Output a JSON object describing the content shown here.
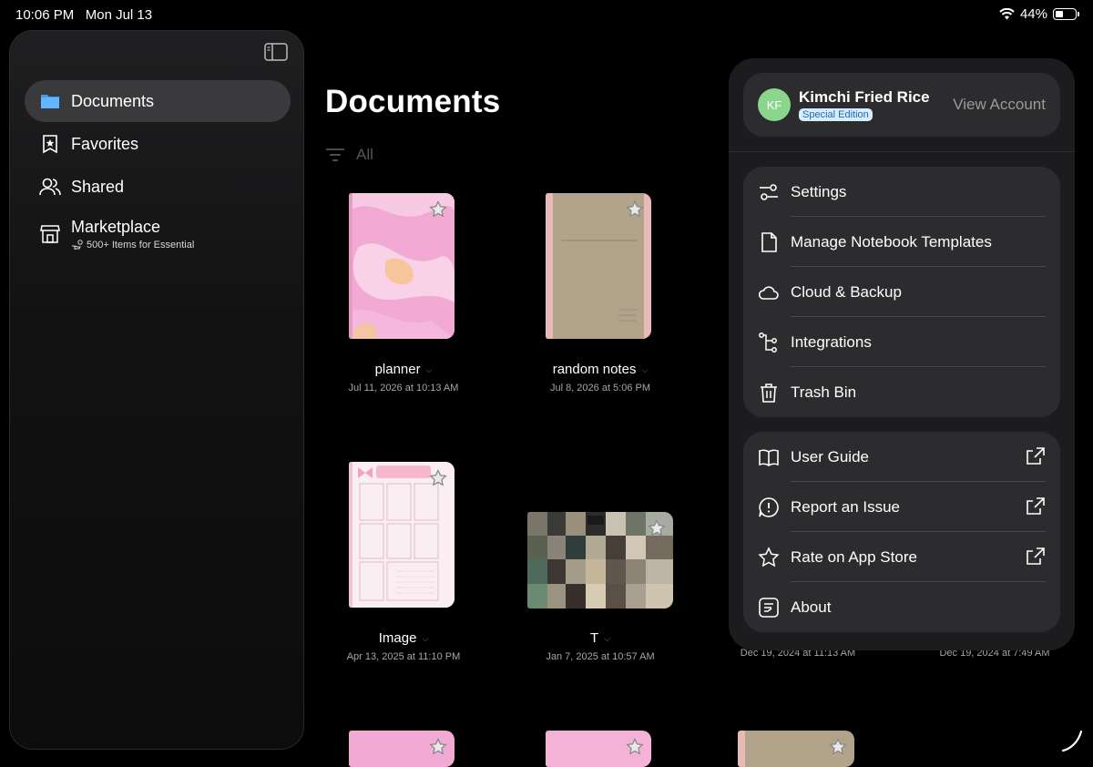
{
  "status": {
    "time": "10:06 PM",
    "date": "Mon Jul 13",
    "battery": "44%"
  },
  "sidebar": {
    "items": [
      {
        "label": "Documents",
        "icon": "folder-icon",
        "active": true
      },
      {
        "label": "Favorites",
        "icon": "bookmark-star-icon"
      },
      {
        "label": "Shared",
        "icon": "people-icon"
      },
      {
        "label": "Marketplace",
        "icon": "storefront-icon",
        "sub": "500+ Items for Essential"
      }
    ]
  },
  "main": {
    "title": "Documents",
    "filter": "All",
    "documents": [
      {
        "name": "planner",
        "date": "Jul 11, 2026 at 10:13 AM",
        "cover": "pink-abstract"
      },
      {
        "name": "random notes",
        "date": "Jul 8, 2026 at 5:06 PM",
        "cover": "khaki"
      },
      {
        "name": "Image",
        "date": "Apr 13, 2025 at 11:10 PM",
        "cover": "weekly-planner"
      },
      {
        "name": "T",
        "date": "Jan 7, 2025 at 10:57 AM",
        "cover": "photo-collage"
      },
      {
        "name": "",
        "date": "Dec 19, 2024 at 11:13 AM",
        "cover": "hidden"
      },
      {
        "name": "",
        "date": "Dec 19, 2024 at 7:49 AM",
        "cover": "hidden"
      }
    ]
  },
  "account": {
    "initials": "KF",
    "name": "Kimchi Fried Rice",
    "edition": "Special Edition",
    "view_account": "View Account",
    "avatar_color": "#8bd68d"
  },
  "menu": {
    "group1": [
      {
        "label": "Settings",
        "icon": "sliders-icon"
      },
      {
        "label": "Manage Notebook Templates",
        "icon": "document-icon"
      },
      {
        "label": "Cloud & Backup",
        "icon": "cloud-icon"
      },
      {
        "label": "Integrations",
        "icon": "integrations-icon"
      },
      {
        "label": "Trash Bin",
        "icon": "trash-icon"
      }
    ],
    "group2": [
      {
        "label": "User Guide",
        "icon": "book-icon",
        "external": true
      },
      {
        "label": "Report an Issue",
        "icon": "alert-bubble-icon",
        "external": true
      },
      {
        "label": "Rate on App Store",
        "icon": "star-icon",
        "external": true
      },
      {
        "label": "About",
        "icon": "notes-icon",
        "external": false
      }
    ]
  }
}
